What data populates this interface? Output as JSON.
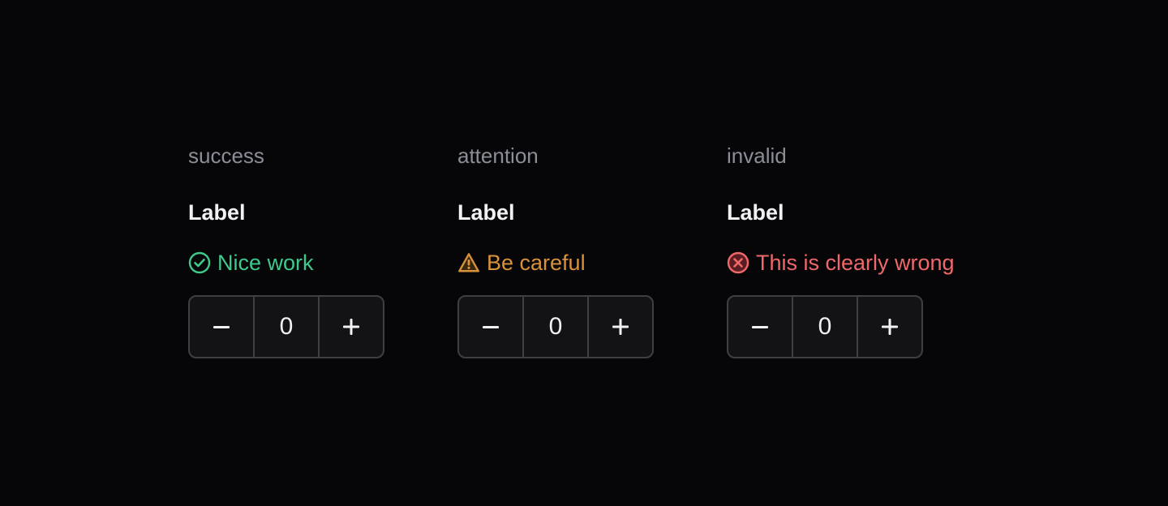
{
  "variants": [
    {
      "title": "success",
      "label": "Label",
      "message": "Nice work",
      "status_icon": "check-circle-icon",
      "color": "#3fc98a",
      "stepper": {
        "value": "0",
        "decrement_icon": "minus-icon",
        "increment_icon": "plus-icon"
      }
    },
    {
      "title": "attention",
      "label": "Label",
      "message": "Be careful",
      "status_icon": "warning-triangle-icon",
      "color": "#d9913a",
      "stepper": {
        "value": "0",
        "decrement_icon": "minus-icon",
        "increment_icon": "plus-icon"
      }
    },
    {
      "title": "invalid",
      "label": "Label",
      "message": "This is clearly wrong",
      "status_icon": "x-circle-icon",
      "color": "#f0686a",
      "stepper": {
        "value": "0",
        "decrement_icon": "minus-icon",
        "increment_icon": "plus-icon"
      }
    }
  ],
  "colors": {
    "background": "#060609",
    "title": "#8b8e96",
    "label": "#f0f1f3",
    "stepper_border": "#3d3f45",
    "stepper_bg": "#131316"
  }
}
